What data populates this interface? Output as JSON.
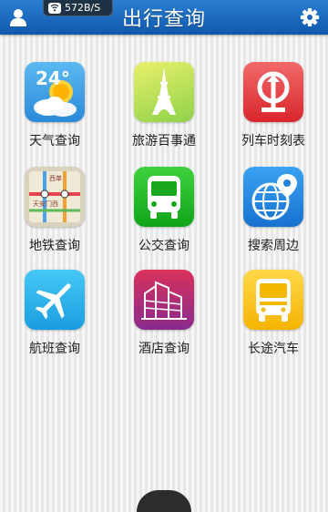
{
  "header": {
    "title": "出行查询",
    "net_speed": "572B/S",
    "user_icon": "user-icon",
    "settings_icon": "gear-icon"
  },
  "tiles": [
    {
      "label": "天气查询",
      "icon": "weather-icon",
      "weather_temp": "24°"
    },
    {
      "label": "旅游百事通",
      "icon": "eiffel-tower-icon"
    },
    {
      "label": "列车时刻表",
      "icon": "railway-logo-icon"
    },
    {
      "label": "地铁查询",
      "icon": "subway-map-icon",
      "map_text_1": "西单",
      "map_text_2": "天安门西"
    },
    {
      "label": "公交查询",
      "icon": "bus-icon"
    },
    {
      "label": "搜索周边",
      "icon": "globe-location-icon"
    },
    {
      "label": "航班查询",
      "icon": "airplane-icon"
    },
    {
      "label": "酒店查询",
      "icon": "hotel-building-icon"
    },
    {
      "label": "长途汽车",
      "icon": "coach-bus-icon"
    }
  ]
}
